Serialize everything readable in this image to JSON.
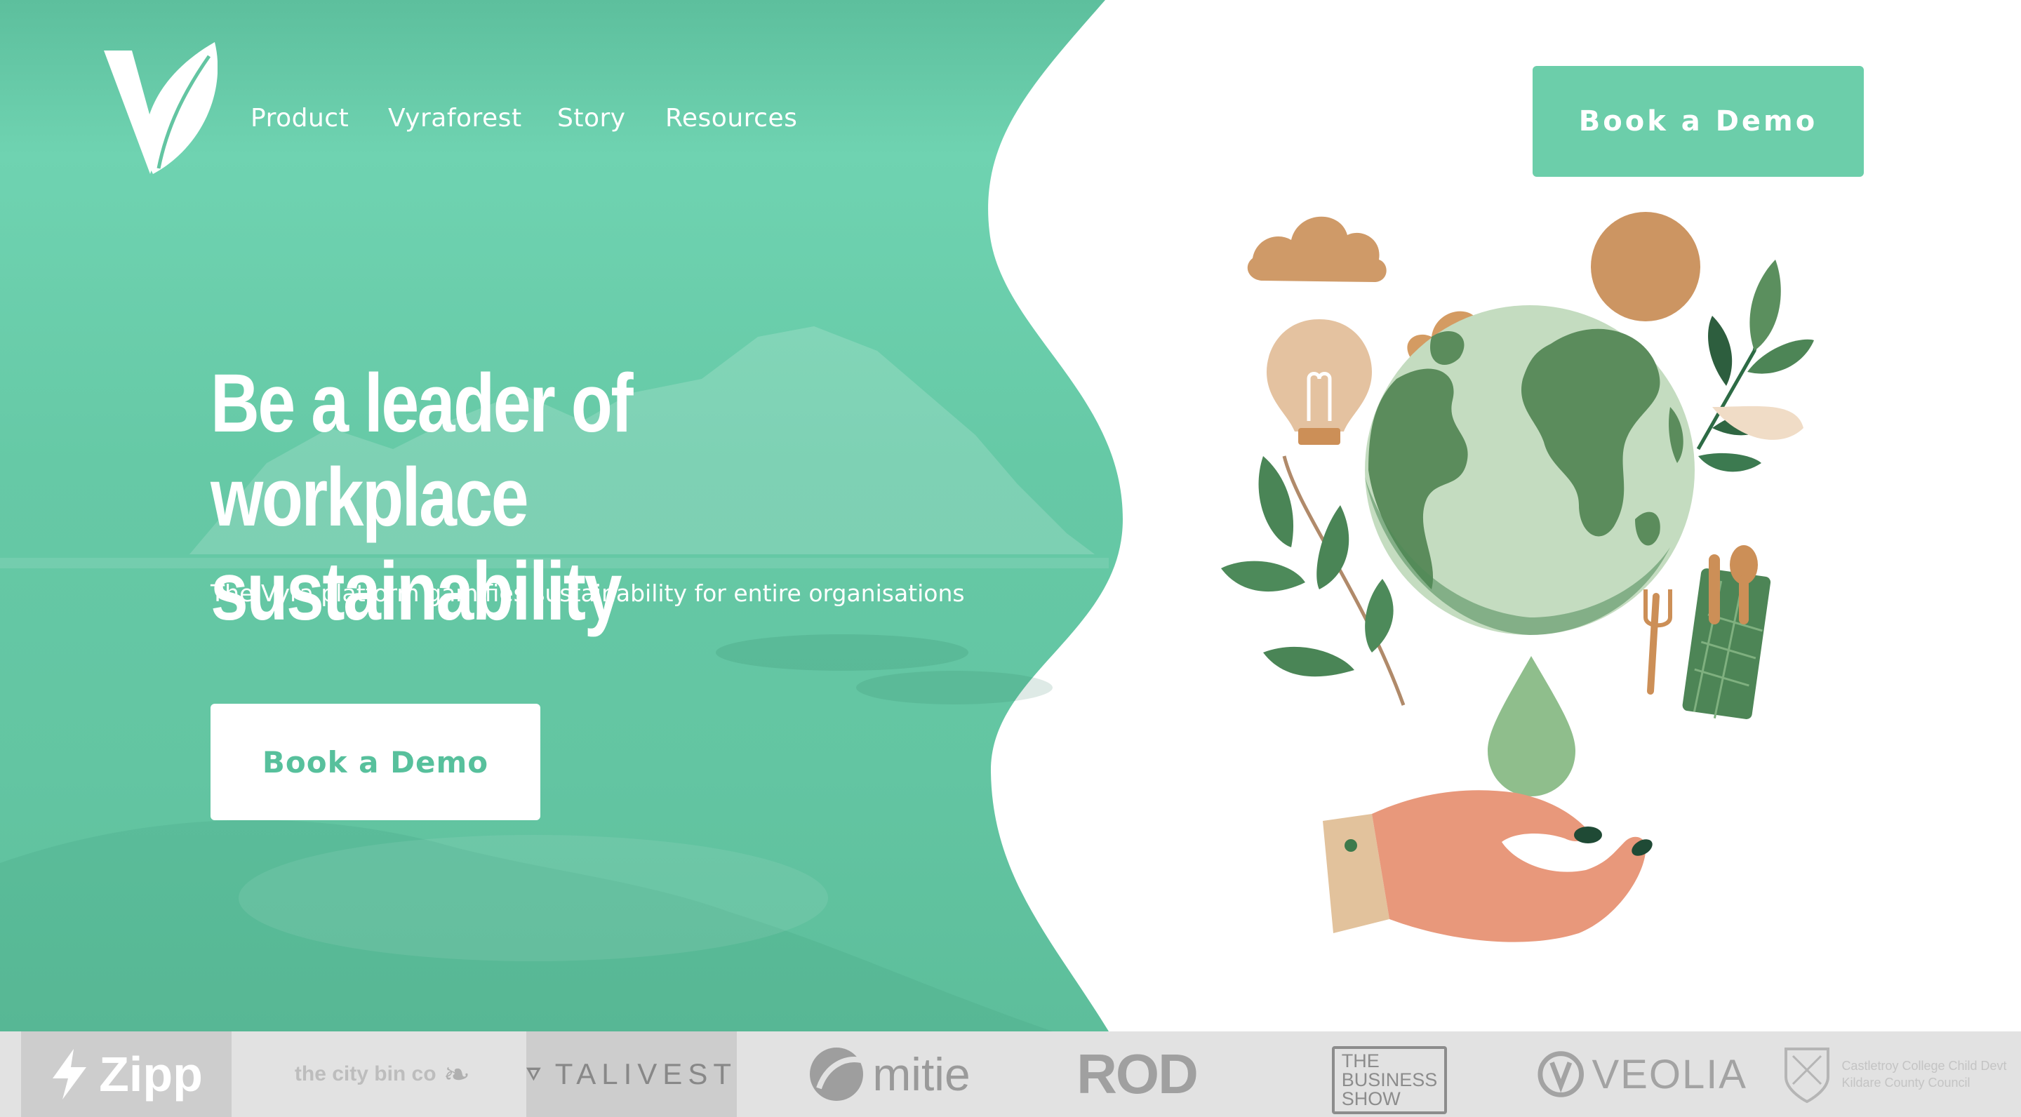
{
  "header": {
    "nav": [
      {
        "label": "Product"
      },
      {
        "label": "Vyraforest"
      },
      {
        "label": "Story"
      },
      {
        "label": "Resources"
      }
    ],
    "cta_label": "Book a Demo"
  },
  "hero": {
    "headline_line1": "Be a leader of workplace",
    "headline_line2": "sustainability",
    "subheadline": "The Vyra platform gamifies sustainability for entire organisations",
    "cta_label": "Book a Demo"
  },
  "partners": [
    {
      "name": "Zipp"
    },
    {
      "name": "the city bin co"
    },
    {
      "name": "TALIVEST"
    },
    {
      "name": "mitie"
    },
    {
      "name": "ROD"
    },
    {
      "name_line1": "THE",
      "name_line2": "BUSINESS",
      "name_line3": "SHOW"
    },
    {
      "name": "VEOLIA"
    },
    {
      "name_line1": "Castletroy College Child Devt",
      "name_line2": "Kildare County Council"
    }
  ],
  "colors": {
    "brand_green": "#6cceaa",
    "hero_overlay": "#5ec3a0",
    "cta_text": "#57c09c",
    "strip_bg": "#e2e2e2"
  },
  "icons": [
    "vyra-leaf-logo",
    "globe-illustration",
    "cloud-icon",
    "sun-icon",
    "lightbulb-icon",
    "leaf-branch-icon",
    "water-drop-icon",
    "hand-icon",
    "cutlery-pouch-icon",
    "bolt-icon"
  ]
}
